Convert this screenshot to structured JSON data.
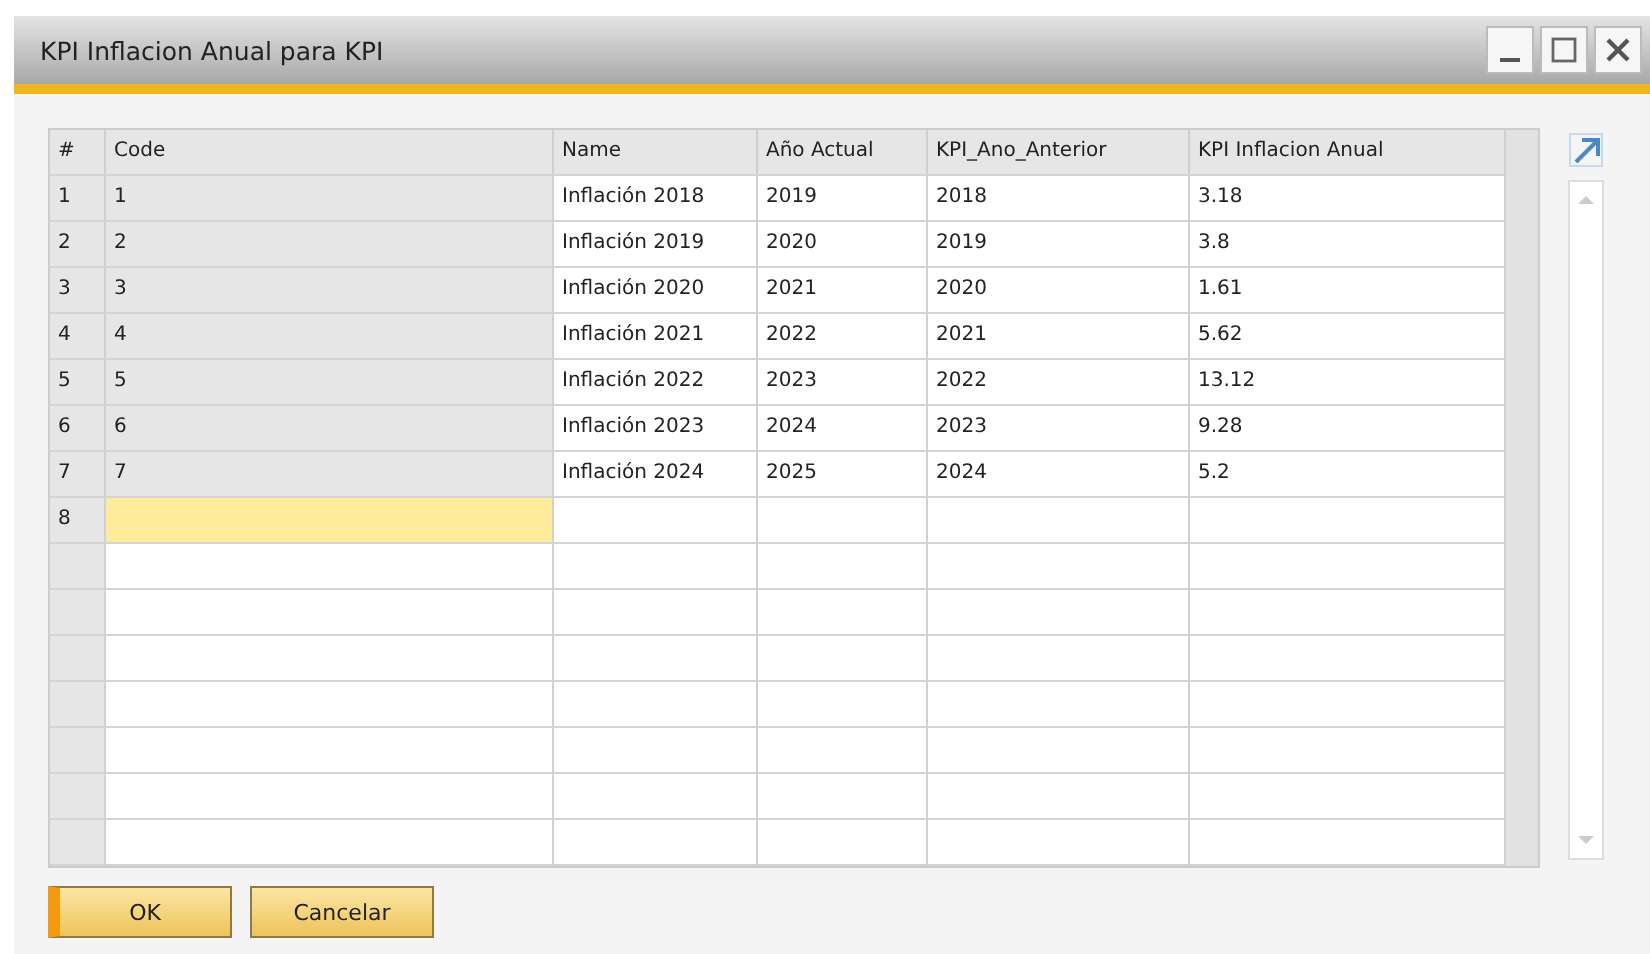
{
  "window": {
    "title": "KPI Inflacion Anual para KPI"
  },
  "table": {
    "columns": [
      "#",
      "Code",
      "Name",
      "Año Actual",
      "KPI_Ano_Anterior",
      "KPI Inflacion Anual"
    ],
    "rows": [
      {
        "cells": [
          "1",
          "1",
          "Inflación 2018",
          "2019",
          "2018",
          "3.18"
        ],
        "focused": false
      },
      {
        "cells": [
          "2",
          "2",
          "Inflación 2019",
          "2020",
          "2019",
          "3.8"
        ],
        "focused": false
      },
      {
        "cells": [
          "3",
          "3",
          "Inflación 2020",
          "2021",
          "2020",
          "1.61"
        ],
        "focused": false
      },
      {
        "cells": [
          "4",
          "4",
          "Inflación 2021",
          "2022",
          "2021",
          "5.62"
        ],
        "focused": false
      },
      {
        "cells": [
          "5",
          "5",
          "Inflación 2022",
          "2023",
          "2022",
          "13.12"
        ],
        "focused": false
      },
      {
        "cells": [
          "6",
          "6",
          "Inflación 2023",
          "2024",
          "2023",
          "9.28"
        ],
        "focused": false
      },
      {
        "cells": [
          "7",
          "7",
          "Inflación 2024",
          "2025",
          "2024",
          "5.2"
        ],
        "focused": false
      },
      {
        "cells": [
          "8",
          "",
          "",
          "",
          "",
          ""
        ],
        "focused": true
      }
    ]
  },
  "buttons": [
    {
      "label": "OK",
      "default": true
    },
    {
      "label": "Cancelar",
      "default": false
    }
  ]
}
